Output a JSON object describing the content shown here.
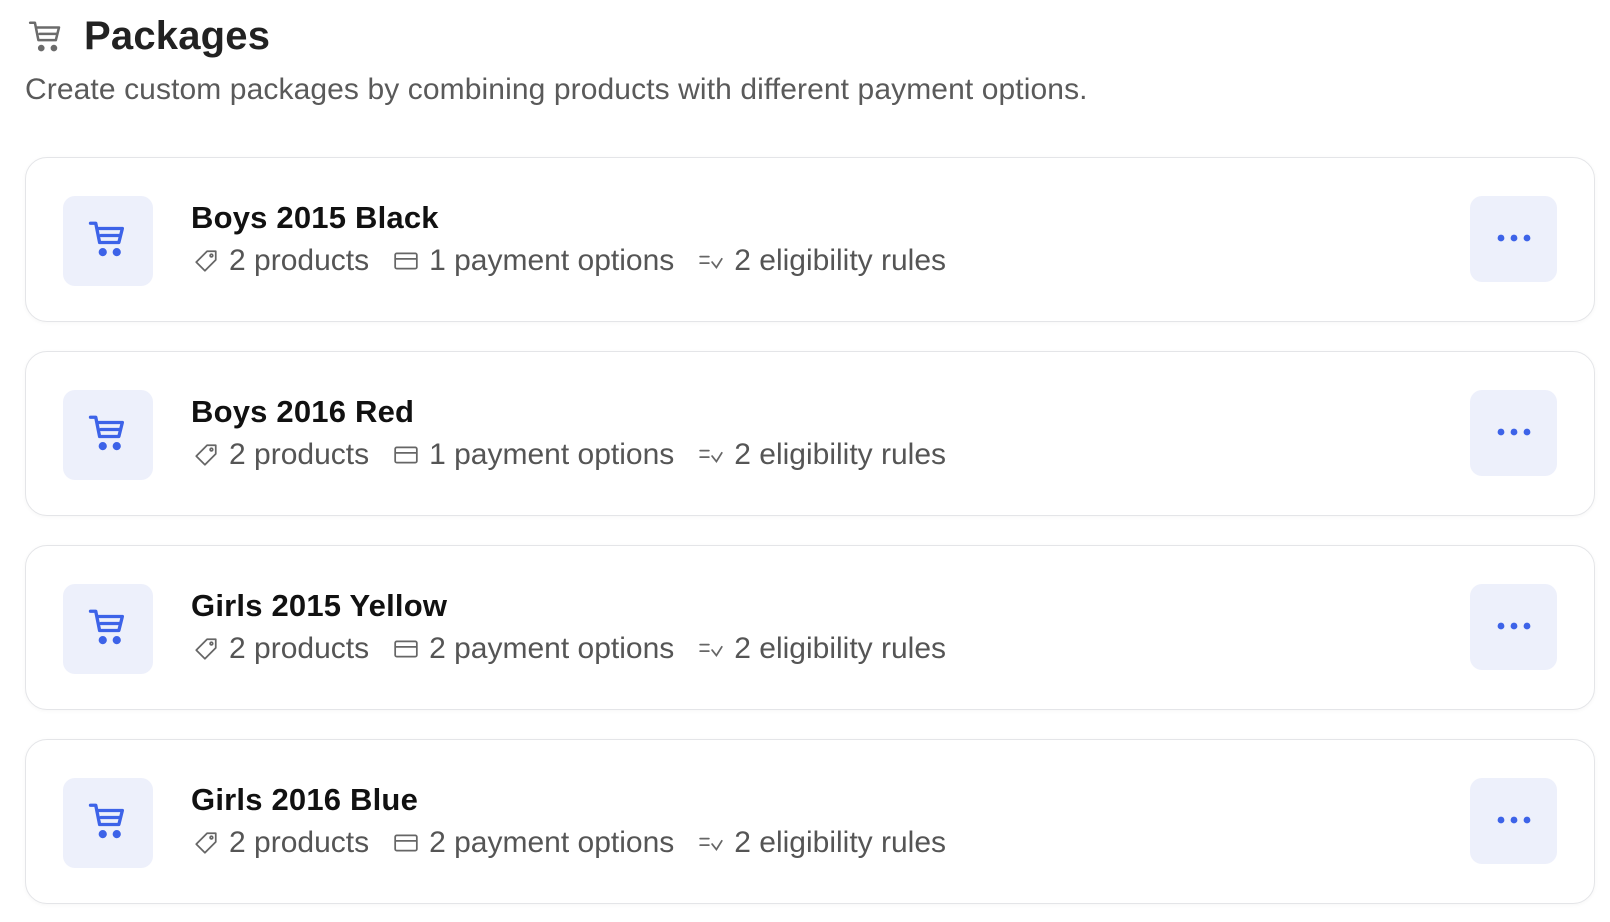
{
  "header": {
    "icon": "cart-icon",
    "title": "Packages",
    "subtitle": "Create custom packages by combining products with different payment options."
  },
  "colors": {
    "accent": "#3d63e8",
    "thumb_bg": "#edf0fb",
    "muted_text": "#555555"
  },
  "packages": [
    {
      "name": "Boys 2015 Black",
      "products": "2 products",
      "payment_options": "1 payment options",
      "eligibility_rules": "2 eligibility rules"
    },
    {
      "name": "Boys 2016 Red",
      "products": "2 products",
      "payment_options": "1 payment options",
      "eligibility_rules": "2 eligibility rules"
    },
    {
      "name": "Girls 2015 Yellow",
      "products": "2 products",
      "payment_options": "2 payment options",
      "eligibility_rules": "2 eligibility rules"
    },
    {
      "name": "Girls 2016 Blue",
      "products": "2 products",
      "payment_options": "2 payment options",
      "eligibility_rules": "2 eligibility rules"
    }
  ],
  "icons": {
    "card_thumb": "cart-icon",
    "products": "tag-icon",
    "payment": "credit-card-icon",
    "eligibility": "list-check-icon",
    "menu": "more-horizontal-icon"
  }
}
